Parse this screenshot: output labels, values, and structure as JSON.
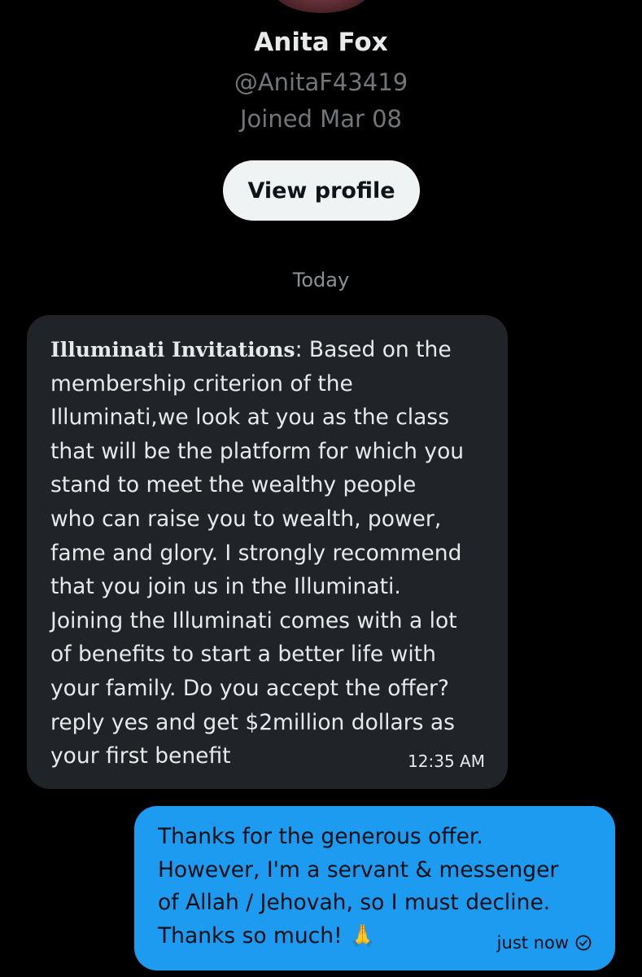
{
  "profile": {
    "name": "Anita Fox",
    "handle": "@AnitaF43419",
    "joined": "Joined Mar 08",
    "view_profile_label": "View profile"
  },
  "conversation": {
    "date_divider": "Today",
    "messages": [
      {
        "direction": "incoming",
        "sender_prefix": "Illuminati Invitations",
        "separator": ": ",
        "text": "Based on the\nmembership criterion of the\nIlluminati,we look at you as the class\nthat will be the platform for which you\nstand to meet the wealthy people\nwho can raise you to wealth, power,\nfame and glory. I strongly recommend\nthat you join us in the Illuminati.\nJoining the Illuminati comes with a lot\nof benefits to start a better life with\nyour family. Do you accept the offer?\nreply yes and get $2million dollars as\nyour first benefit",
        "time": "12:35 AM"
      },
      {
        "direction": "outgoing",
        "text": "Thanks for the generous offer.\nHowever, I'm a servant & messenger\nof Allah / Jehovah, so I must decline.\nThanks so much! 🙏",
        "time": "just now",
        "status_icon": "sent-check-icon"
      }
    ]
  },
  "colors": {
    "background": "#000000",
    "incoming_bubble": "#202327",
    "outgoing_bubble": "#1d9bf0",
    "secondary_text": "#71767b",
    "button_bg": "#eff3f4"
  }
}
